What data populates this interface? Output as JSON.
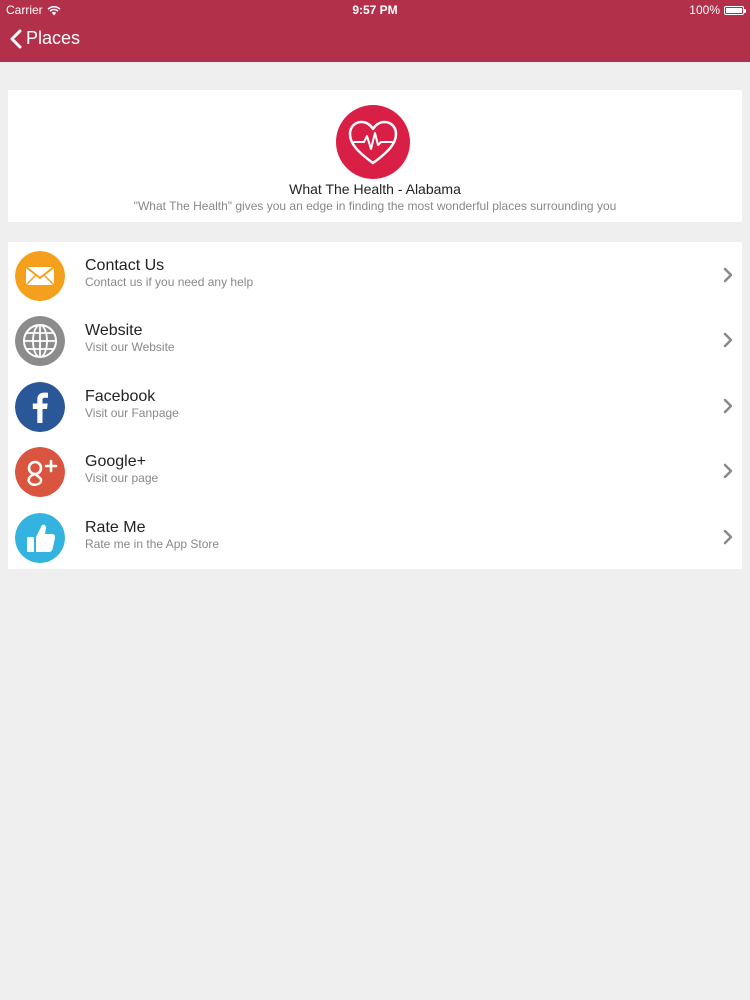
{
  "status_bar": {
    "carrier": "Carrier",
    "time": "9:57 PM",
    "battery": "100%",
    "battery_level": 1.0
  },
  "nav": {
    "back_label": "Places"
  },
  "header": {
    "title": "What The Health - Alabama",
    "tagline": "\"What The Health\" gives you an edge in finding the most wonderful places surrounding you"
  },
  "menu": {
    "items": [
      {
        "title": "Contact Us",
        "subtitle": "Contact us if you need any help",
        "icon": "envelope-icon",
        "color": "#f4a01c"
      },
      {
        "title": "Website",
        "subtitle": "Visit our Website",
        "icon": "globe-icon",
        "color": "#8c8c8c"
      },
      {
        "title": "Facebook",
        "subtitle": "Visit our Fanpage",
        "icon": "facebook-icon",
        "color": "#2a5797"
      },
      {
        "title": "Google+",
        "subtitle": "Visit our page",
        "icon": "google-plus-icon",
        "color": "#d9553f"
      },
      {
        "title": "Rate Me",
        "subtitle": "Rate me in the App Store",
        "icon": "thumbs-up-icon",
        "color": "#34b2e0"
      }
    ]
  },
  "colors": {
    "accent": "#b3304a",
    "background": "#efefef",
    "logo": "#d91f45"
  }
}
